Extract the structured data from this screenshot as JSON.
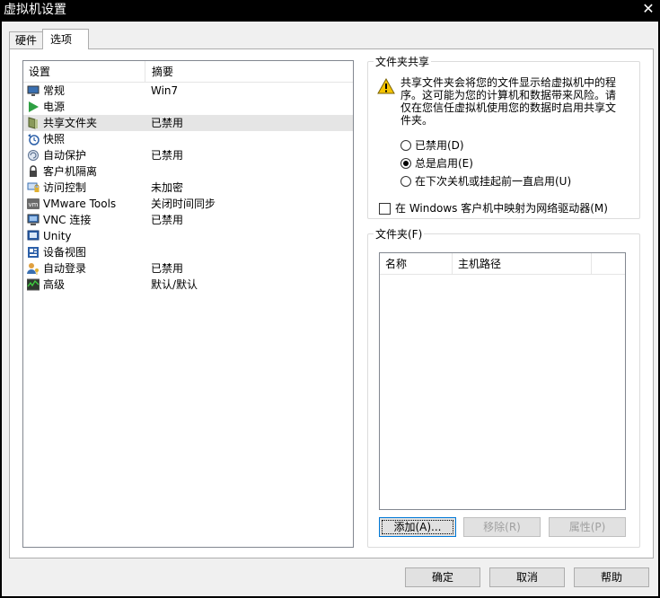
{
  "window": {
    "title": "虚拟机设置",
    "close_glyph": "✕"
  },
  "tabs": [
    {
      "label": "硬件"
    },
    {
      "label": "选项"
    }
  ],
  "settings_list": {
    "headers": {
      "setting": "设置",
      "summary": "摘要"
    },
    "rows": [
      {
        "icon": "monitor-icon",
        "name": "常规",
        "summary": "Win7"
      },
      {
        "icon": "play-icon",
        "name": "电源",
        "summary": ""
      },
      {
        "icon": "shared-folder-icon",
        "name": "共享文件夹",
        "summary": "已禁用",
        "selected": true
      },
      {
        "icon": "snapshot-clock-icon",
        "name": "快照",
        "summary": ""
      },
      {
        "icon": "autoprotect-icon",
        "name": "自动保护",
        "summary": "已禁用"
      },
      {
        "icon": "lock-icon",
        "name": "客户机隔离",
        "summary": ""
      },
      {
        "icon": "access-control-icon",
        "name": "访问控制",
        "summary": "未加密"
      },
      {
        "icon": "vmware-tools-icon",
        "name": "VMware Tools",
        "summary": "关闭时间同步"
      },
      {
        "icon": "vnc-icon",
        "name": "VNC 连接",
        "summary": "已禁用"
      },
      {
        "icon": "unity-icon",
        "name": "Unity",
        "summary": ""
      },
      {
        "icon": "device-view-icon",
        "name": "设备视图",
        "summary": ""
      },
      {
        "icon": "auto-login-icon",
        "name": "自动登录",
        "summary": "已禁用"
      },
      {
        "icon": "advanced-icon",
        "name": "高级",
        "summary": "默认/默认"
      }
    ]
  },
  "folder_sharing": {
    "legend": "文件夹共享",
    "warning_text": "共享文件夹会将您的文件显示给虚拟机中的程序。这可能为您的计算机和数据带来风险。请仅在您信任虚拟机使用您的数据时启用共享文件夹。",
    "options": [
      {
        "label": "已禁用(D)",
        "checked": false
      },
      {
        "label": "总是启用(E)",
        "checked": true
      },
      {
        "label": "在下次关机或挂起前一直启用(U)",
        "checked": false
      }
    ],
    "map_drive_label": "在 Windows 客户机中映射为网络驱动器(M)",
    "map_drive_checked": false
  },
  "folders": {
    "legend": "文件夹(F)",
    "headers": {
      "name": "名称",
      "host_path": "主机路径"
    },
    "add_button": "添加(A)...",
    "remove_button": "移除(R)",
    "properties_button": "属性(P)"
  },
  "dialog_buttons": {
    "ok": "确定",
    "cancel": "取消",
    "help": "帮助"
  },
  "colors": {
    "warning": "#f5c400",
    "power": "#2ea043",
    "selection": "#e5e5e5"
  }
}
